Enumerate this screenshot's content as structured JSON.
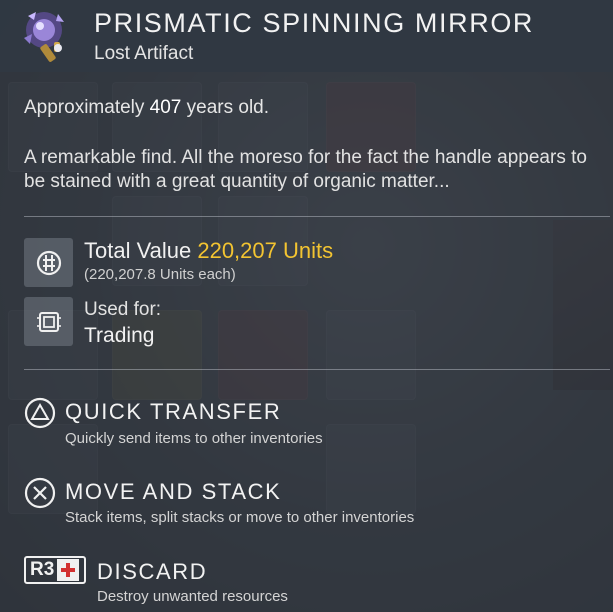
{
  "item": {
    "title": "PRISMATIC SPINNING MIRROR",
    "subtitle": "Lost Artifact",
    "icon": "spinning-mirror-artifact-icon"
  },
  "age": {
    "prefix": "Approximately ",
    "years": "407",
    "suffix": " years old."
  },
  "description": "A remarkable find. All the moreso for the fact the handle appears to be stained with a great quantity of organic matter...",
  "value": {
    "label": "Total Value ",
    "amount": "220,207 Units",
    "each": "(220,207.8 Units each)",
    "icon": "units-currency-icon",
    "amount_color": "#f3c431"
  },
  "used_for": {
    "label": "Used for:",
    "value": "Trading",
    "icon": "trade-module-icon"
  },
  "actions": [
    {
      "title": "QUICK TRANSFER",
      "desc": "Quickly send items to other inventories",
      "icon": "triangle-button-icon"
    },
    {
      "title": "MOVE AND STACK",
      "desc": "Stack items, split stacks or move to other inventories",
      "icon": "cross-button-icon"
    },
    {
      "title": "DISCARD",
      "desc": "Destroy unwanted resources",
      "icon": "r3-button-icon",
      "button_label": "R3"
    }
  ]
}
